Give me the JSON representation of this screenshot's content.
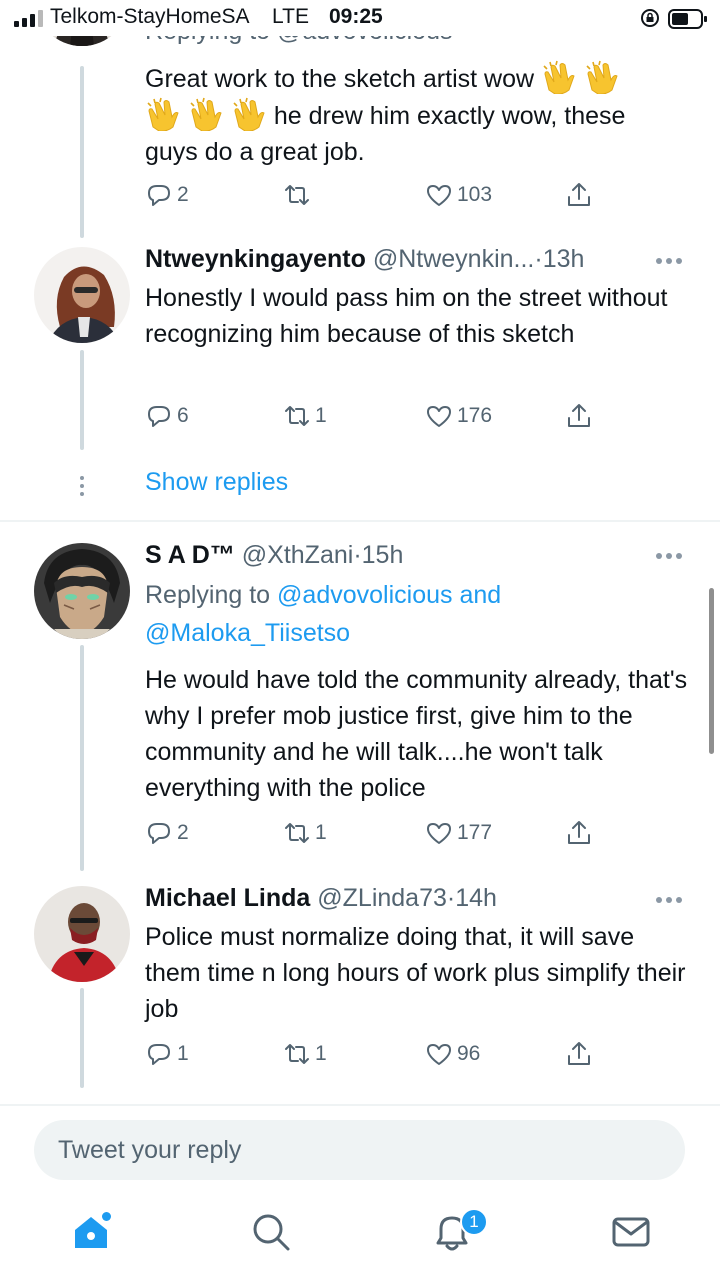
{
  "status_bar": {
    "carrier": "Telkom-StayHomeSA",
    "network": "LTE",
    "time": "09:25"
  },
  "tweets": [
    {
      "replying_partial": "Replying to @advovolicious",
      "text_1": "Great work to the sketch artist wow",
      "text_2": "he drew him exactly wow, these",
      "text_3": "guys do a great job.",
      "emoji_icon": "clapping-hands-icon",
      "replies": "2",
      "retweets": "",
      "likes": "103"
    },
    {
      "name": "Ntweynkingayento",
      "handle": "@Ntweynkin...",
      "dot": "·",
      "time": "13h",
      "text": "Honestly I would pass him on the street without recognizing him because of this sketch",
      "replies": "6",
      "retweets": "1",
      "likes": "176"
    },
    {
      "name": "S A D™",
      "handle": "@XthZani",
      "dot": "·",
      "time": "15h",
      "replying_prefix": "Replying to",
      "replying_users": "@advovolicious and",
      "replying_users_2": "@Maloka_Tiisetso",
      "text": "He would have told the community already, that's why I prefer mob justice first, give him to the community and he will talk....he won't talk everything with the police",
      "replies": "2",
      "retweets": "1",
      "likes": "177"
    },
    {
      "name": "Michael Linda",
      "handle": "@ZLinda73",
      "dot": "·",
      "time": "14h",
      "text": "Police must normalize doing that, it will save them time n long hours of work plus simplify their job",
      "replies": "1",
      "retweets": "1",
      "likes": "96"
    }
  ],
  "show_replies": "Show replies",
  "composer": {
    "placeholder": "Tweet your reply"
  },
  "tabbar": {
    "notifications_badge": "1",
    "tabs": [
      "home-icon",
      "search-icon",
      "notifications-icon",
      "messages-icon"
    ]
  },
  "colors": {
    "accent": "#1d9bf0",
    "muted": "#536471",
    "text": "#0f1419"
  }
}
